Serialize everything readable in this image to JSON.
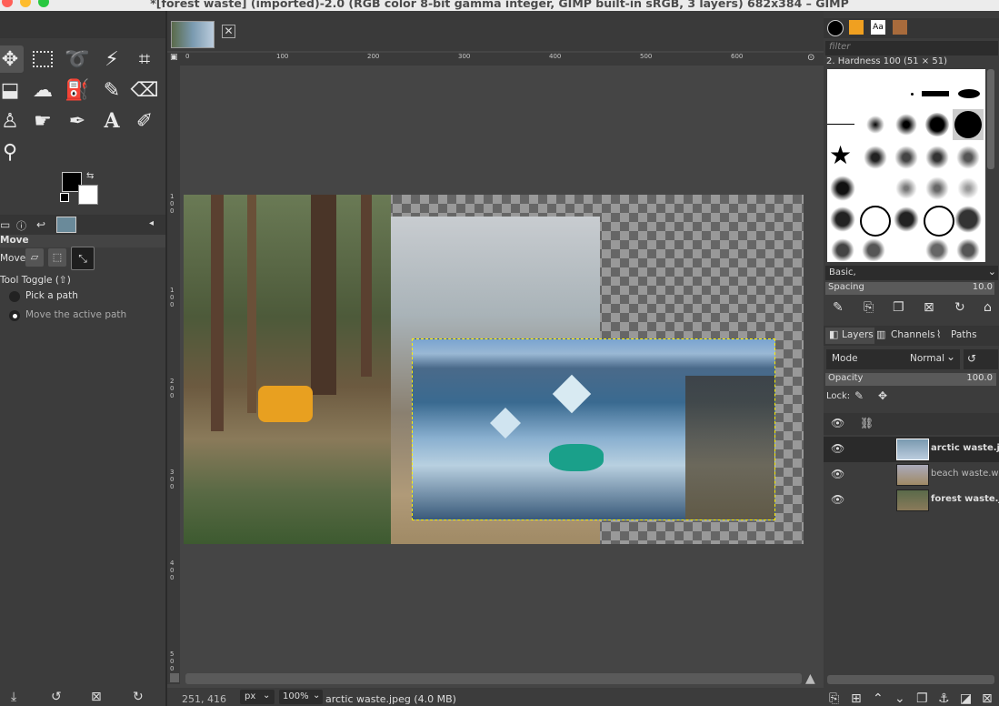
{
  "window": {
    "title": "*[forest waste] (imported)-2.0 (RGB color 8-bit gamma integer, GIMP built-in sRGB, 3 layers) 682x384 – GIMP",
    "traffic_colors": [
      "#ff5f57",
      "#febc2e",
      "#28c840"
    ]
  },
  "toolbox": {
    "tools": [
      "move-tool-icon",
      "rect-select-icon",
      "lasso-icon",
      "fuzzy-select-icon",
      "crop-icon",
      "unified-transform-icon",
      "warp-icon",
      "bucket-fill-icon",
      "paintbrush-icon",
      "eraser-icon",
      "clone-icon",
      "smudge-icon",
      "paths-icon",
      "text-icon",
      "color-picker-icon",
      "zoom-icon"
    ],
    "tool_options": {
      "title": "Move",
      "move_label": "Move:",
      "toggle_label": "Tool Toggle  (⇧)",
      "option1": "Pick a path",
      "option2": "Move the active path"
    }
  },
  "canvas": {
    "tab_close": "✕",
    "ruler_labels": [
      "0",
      "100",
      "200",
      "300",
      "400",
      "500",
      "600"
    ],
    "vruler_labels": [
      "1",
      "0",
      "0",
      "0",
      "1",
      "0",
      "0",
      "2",
      "0",
      "0",
      "3",
      "0",
      "0",
      "4",
      "0",
      "0",
      "5",
      "0",
      "0"
    ]
  },
  "statusbar": {
    "coords": "251, 416",
    "unit": "px",
    "zoom": "100%",
    "info": "arctic waste.jpeg (4.0 MB)"
  },
  "brushes": {
    "filter_placeholder": "filter",
    "selected": "2. Hardness 100 (51 × 51)",
    "preset": "Basic,",
    "spacing_label": "Spacing",
    "spacing_value": "10.0"
  },
  "layers_panel": {
    "tabs": [
      "Layers",
      "Channels",
      "Paths"
    ],
    "mode_label": "Mode",
    "mode_value": "Normal",
    "opacity_label": "Opacity",
    "opacity_value": "100.0",
    "lock_label": "Lock:",
    "layers": [
      {
        "name": "arctic waste.jpeg",
        "active": true
      },
      {
        "name": "beach waste.webp",
        "active": false
      },
      {
        "name": "forest waste.jpeg",
        "active": false
      }
    ]
  }
}
